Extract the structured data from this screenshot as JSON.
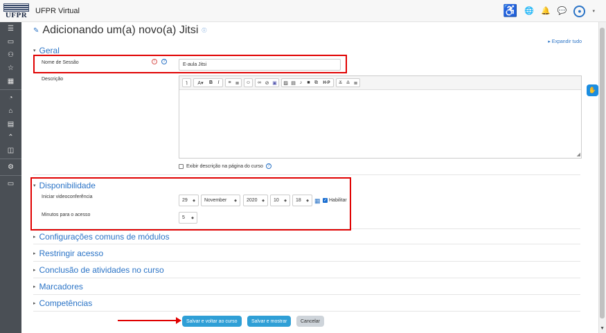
{
  "header": {
    "logo_text": "UFPR",
    "site_name": "UFPR Virtual"
  },
  "page": {
    "title": "Adicionando um(a) novo(a) Jitsi",
    "expand_all": "Expandir tudo"
  },
  "geral": {
    "title": "Geral",
    "session_name_label": "Nome de Sessão",
    "session_name_value": "E-aula Jitsi",
    "description_label": "Descrição",
    "show_description_label": "Exibir descrição na página do curso"
  },
  "disponibilidade": {
    "title": "Disponibilidade",
    "start_label": "Iniciar videoconferência",
    "day": "29",
    "month": "November",
    "year": "2020",
    "hour": "10",
    "minute": "18",
    "enable_label": "Habilitar",
    "minutes_label": "Minutos para o acesso",
    "minutes_value": "5"
  },
  "collapsed_sections": [
    "Configurações comuns de módulos",
    "Restringir acesso",
    "Conclusão de atividades no curso",
    "Marcadores",
    "Competências"
  ],
  "buttons": {
    "save_return": "Salvar e voltar ao curso",
    "save_show": "Salvar e mostrar",
    "cancel": "Cancelar"
  },
  "toolbar_icons": [
    "paragraph-icon",
    "font-color-icon",
    "bold-icon",
    "italic-icon",
    "unordered-list-icon",
    "ordered-list-icon",
    "emoji-icon",
    "link-icon",
    "unlink-icon",
    "teams-icon",
    "image-icon",
    "media-icon",
    "record-audio-icon",
    "record-video-icon",
    "manage-files-icon",
    "h5p-icon",
    "undo-icon",
    "redo-icon",
    "accessibility-icon"
  ],
  "colors": {
    "accent": "#2a73c6",
    "highlight": "#e00000",
    "sidebar": "#4a4f55",
    "primary_button": "#2f9fd6"
  }
}
